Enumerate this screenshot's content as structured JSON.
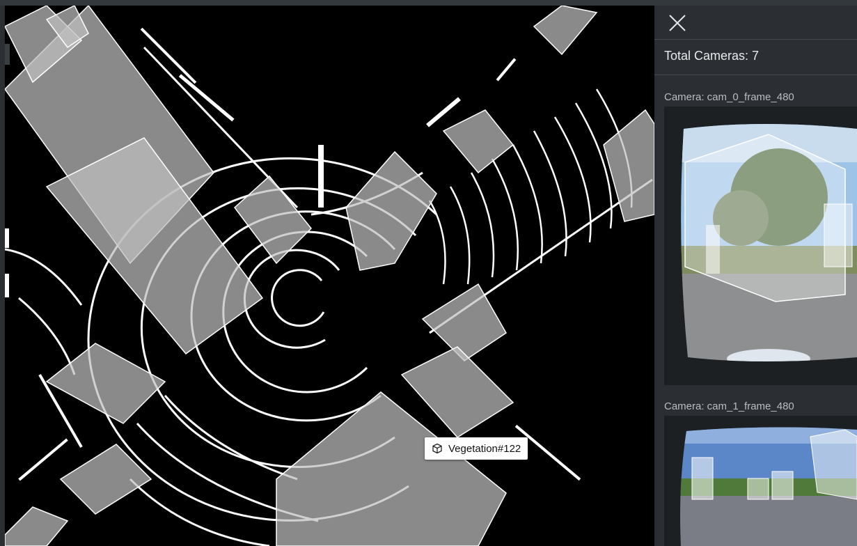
{
  "viewer": {
    "tooltip": {
      "icon": "cube-icon",
      "label": "Vegetation#122"
    }
  },
  "sidebar": {
    "close_icon": "close-icon",
    "total_cameras": "Total Cameras: 7",
    "cameras": [
      {
        "label": "Camera: cam_0_frame_480"
      },
      {
        "label": "Camera: cam_1_frame_480"
      }
    ]
  },
  "colors": {
    "viewer_background": "#000000",
    "sidebar_background": "#2b2f33",
    "box_fill": "#bfbfbf",
    "lidar_points": "#ffffff"
  }
}
